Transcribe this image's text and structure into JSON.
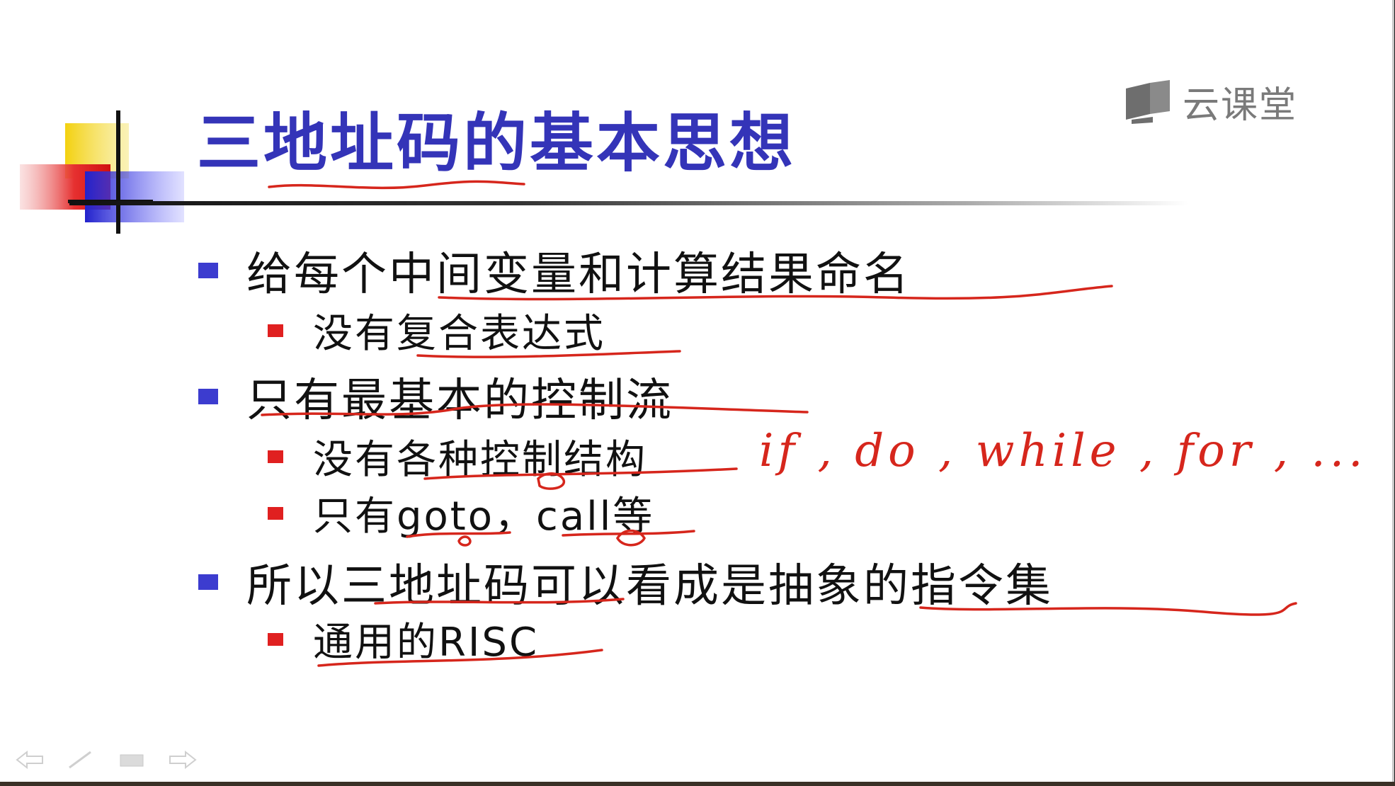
{
  "logo": {
    "text": "云课堂",
    "icon": "book-icon"
  },
  "title": "三地址码的基本思想",
  "bullets": [
    {
      "text": "给每个中间变量和计算结果命名",
      "subs": [
        "没有复合表达式"
      ]
    },
    {
      "text": "只有最基本的控制流",
      "subs": [
        "没有各种控制结构",
        "只有goto，call等"
      ]
    },
    {
      "text": "所以三地址码可以看成是抽象的指令集",
      "subs": [
        "通用的RISC"
      ]
    }
  ],
  "handwriting": "if , do , while , for , ...",
  "nav": {
    "prev_icon": "arrow-left-icon",
    "pen_icon": "pen-icon",
    "menu_icon": "slide-menu-icon",
    "next_icon": "arrow-right-icon"
  },
  "colors": {
    "title": "#3434b8",
    "bullet_level1": "#3c3ccf",
    "bullet_level2": "#e02020",
    "ink": "#d6261c"
  }
}
